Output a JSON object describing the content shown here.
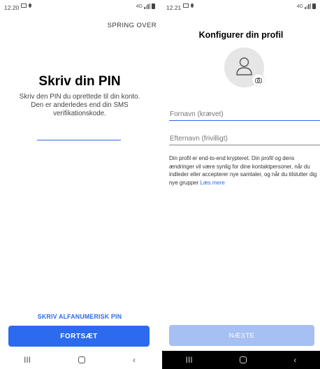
{
  "left": {
    "status_time": "12.20",
    "skip_label": "SPRING OVER",
    "title": "Skriv din PIN",
    "description": "Skriv den PIN du oprettede til din konto. Den er anderledes end din SMS verifikationskode.",
    "pin_value": "",
    "alphanumeric_link": "SKRIV ALFANUMERISK PIN",
    "continue_label": "FORTSÆT",
    "nav_recents": "III",
    "nav_back": "‹"
  },
  "right": {
    "status_time": "12.21",
    "title": "Konfigurer din profil",
    "first_name_placeholder": "Fornavn (krævet)",
    "last_name_placeholder": "Efternavn (frivilligt)",
    "info_text": "Din profil er end-to-end krypteret. Din profil og dens ændringer vil være synlig for dine kontaktpersoner, når du indleder eller accepterer nye samtaler, og når du tilslutter dig nye grupper ",
    "learn_more": "Læs mere",
    "next_label": "NÆSTE",
    "nav_recents": "III",
    "nav_back": "‹"
  },
  "status_right_text": "4G",
  "icons": {
    "avatar": "person-outline-icon",
    "camera": "camera-icon",
    "home": "home-square-icon"
  },
  "colors": {
    "accent": "#2c6bed",
    "accent_disabled": "#a6c0f3",
    "avatar_bg": "#e6e6e6"
  }
}
